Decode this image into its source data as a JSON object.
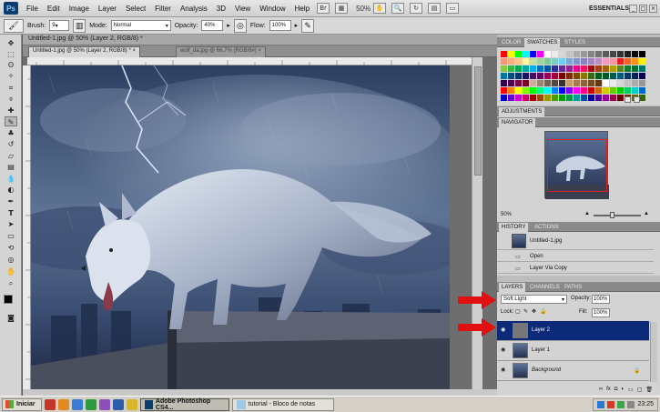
{
  "menubar": {
    "logo": "Ps",
    "menus": [
      "File",
      "Edit",
      "Image",
      "Layer",
      "Select",
      "Filter",
      "Analysis",
      "3D",
      "View",
      "Window",
      "Help"
    ],
    "zoom": "50%",
    "workspace": "ESSENTIALS"
  },
  "options_bar": {
    "brush_label": "Brush:",
    "brush_size": "9",
    "mode_label": "Mode:",
    "mode_value": "Normal",
    "opacity_label": "Opacity:",
    "opacity_value": "40%",
    "flow_label": "Flow:",
    "flow_value": "100%"
  },
  "documents": {
    "window_title": "Untitled-1.jpg @ 50% (Layer 2, RGB/8) *",
    "tabs": [
      {
        "label": "Untitled-1.jpg @ 50% (Layer 2, RGB/8) *",
        "active": true
      },
      {
        "label": "wolf_da.jpg @ 66,7% (RGB/8#)",
        "active": false
      }
    ]
  },
  "panels": {
    "color_tabs": [
      "COLOR",
      "SWATCHES",
      "STYLES"
    ],
    "adjustments_title": "ADJUSTMENTS",
    "navigator_title": "NAVIGATOR",
    "navigator_zoom": "50%",
    "history_tabs": [
      "HISTORY",
      "ACTIONS"
    ],
    "history_snapshot": "Untitled-1.jpg",
    "history_items": [
      "Open",
      "Layer Via Copy"
    ],
    "layers_tabs": [
      "LAYERS",
      "CHANNELS",
      "PATHS"
    ],
    "blend_mode": "Soft Light",
    "opacity_label": "Opacity:",
    "opacity_value": "100%",
    "lock_label": "Lock:",
    "fill_label": "Fill:",
    "fill_value": "100%",
    "layers": [
      {
        "name": "Layer 2",
        "selected": true
      },
      {
        "name": "Layer 1",
        "selected": false
      },
      {
        "name": "Background",
        "selected": false
      }
    ]
  },
  "taskbar": {
    "start": "Iniciar",
    "tasks": [
      {
        "label": "Adobe Photoshop CS4...",
        "active": true
      },
      {
        "label": "tutorial - Bloco de notas",
        "active": false
      }
    ],
    "clock": "23:25"
  },
  "colors": {
    "selected_layer": "#0c2a78",
    "arrow": "#e01010"
  }
}
